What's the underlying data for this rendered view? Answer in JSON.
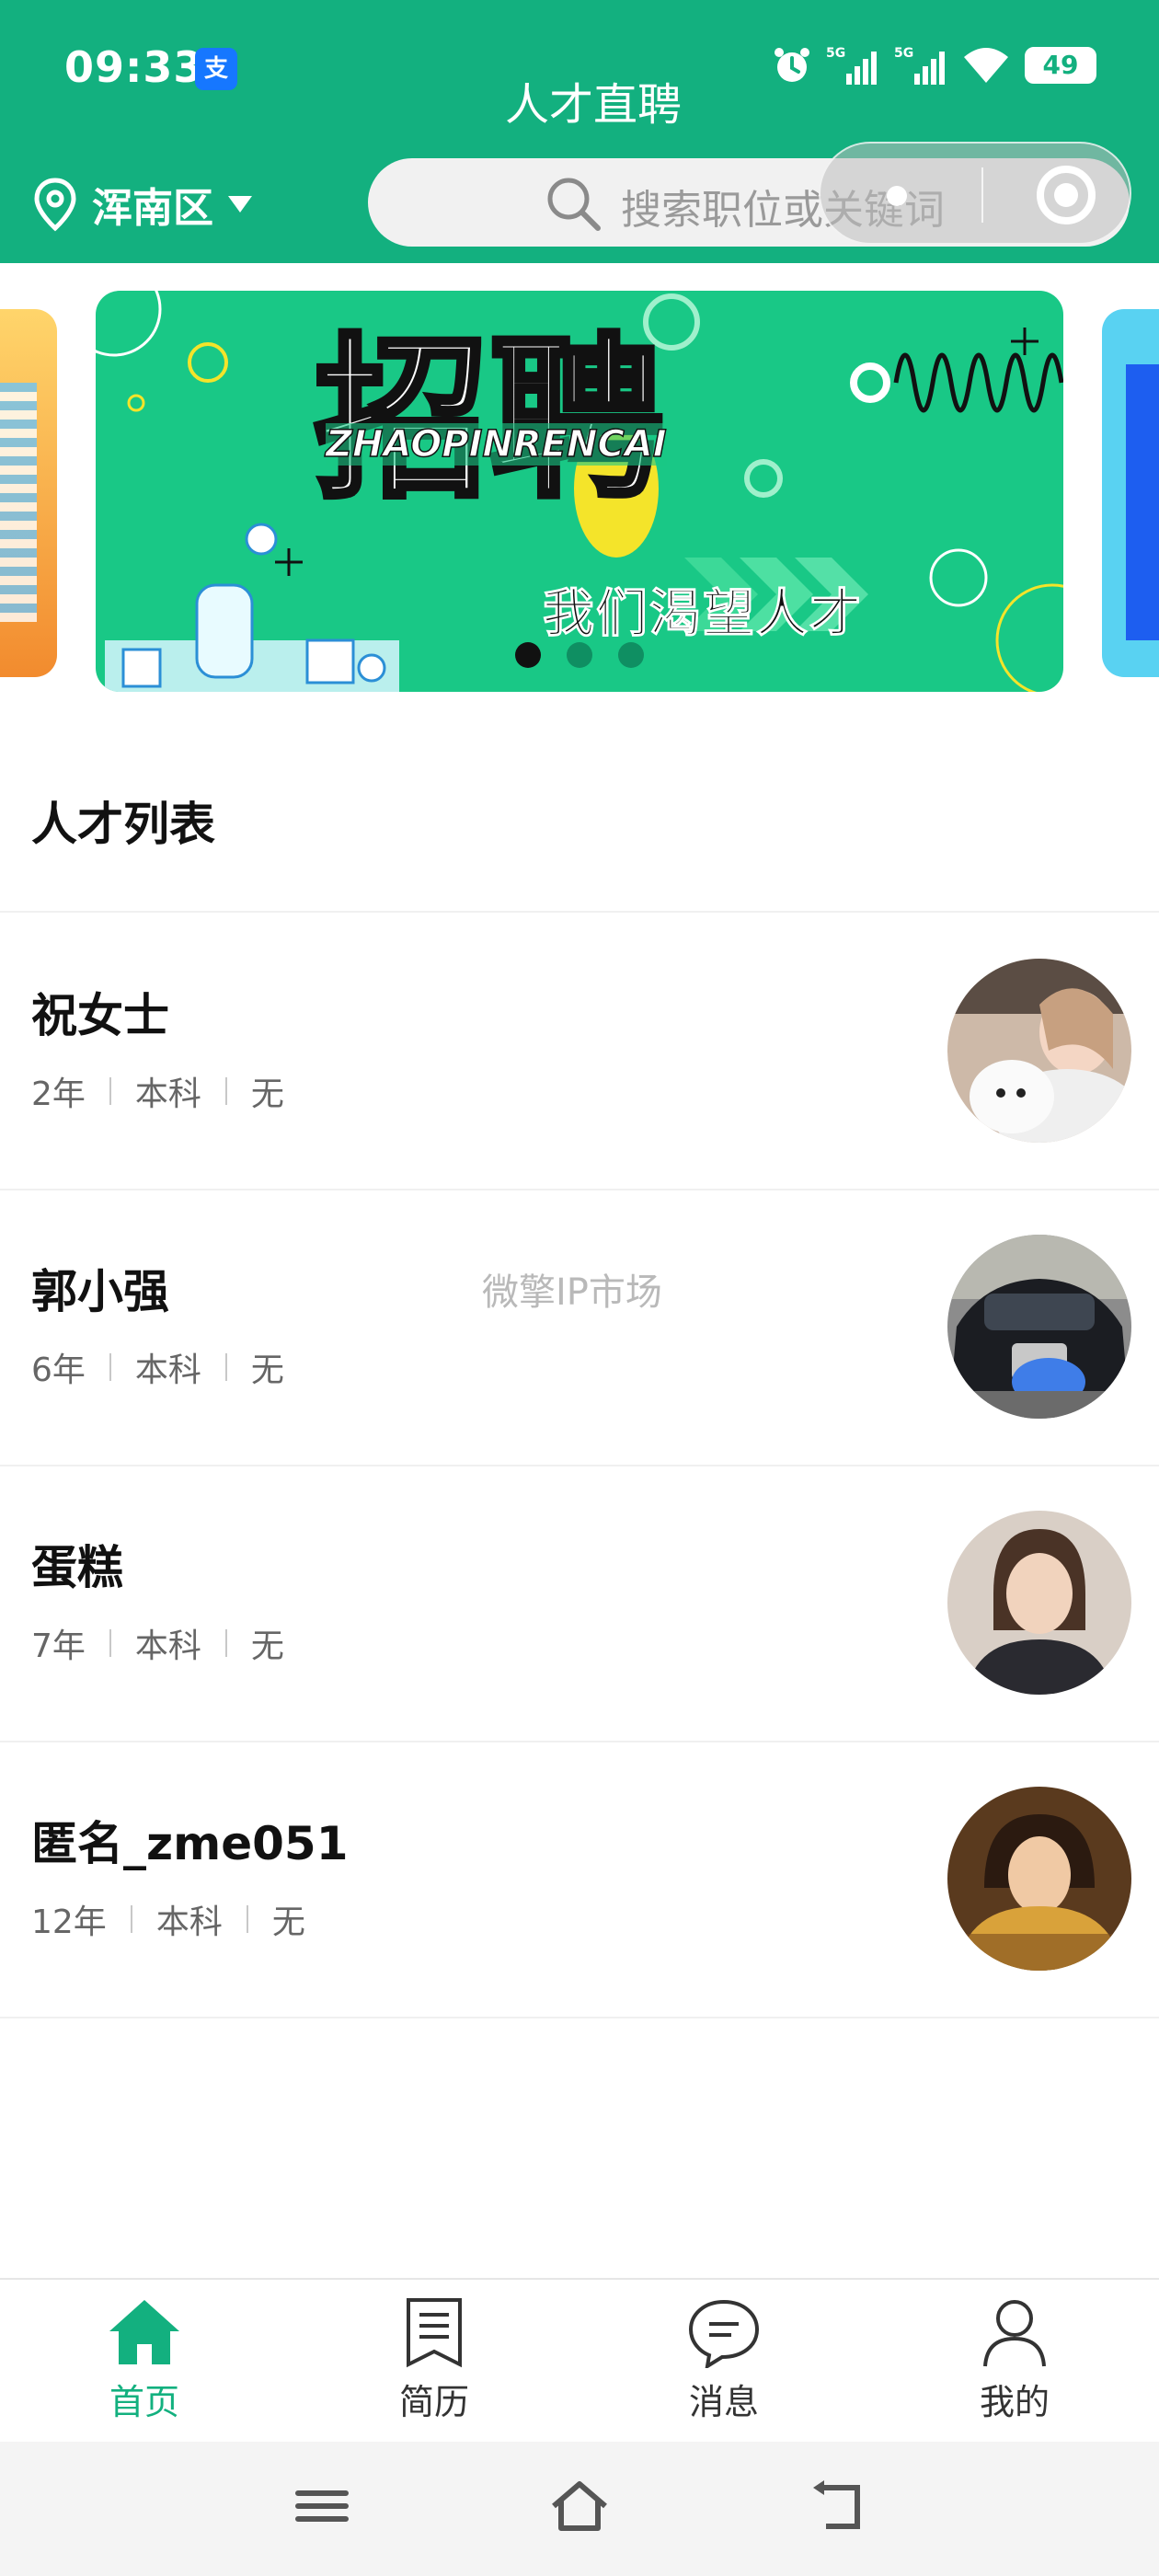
{
  "status_bar": {
    "time": "09:33",
    "app_badge": "支",
    "battery": "49",
    "network_labels": [
      "5G",
      "5G"
    ]
  },
  "header": {
    "title": "人才直聘",
    "location": "浑南区",
    "search_placeholder": "搜索职位或关键词"
  },
  "banner": {
    "title": "招聘",
    "subtitle": "ZHAOPINRENCAI",
    "slogan": "我们渴望人才",
    "slide_count": 3,
    "active_slide": 1
  },
  "talent_list": {
    "title": "人才列表",
    "items": [
      {
        "name": "祝女士",
        "years": "2年",
        "education": "本科",
        "other": "无"
      },
      {
        "name": "郭小强",
        "years": "6年",
        "education": "本科",
        "other": "无"
      },
      {
        "name": "蛋糕",
        "years": "7年",
        "education": "本科",
        "other": "无"
      },
      {
        "name": "匿名_zme051",
        "years": "12年",
        "education": "本科",
        "other": "无"
      }
    ]
  },
  "watermark": "微擎IP市场",
  "tabbar": {
    "items": [
      {
        "label": "首页",
        "icon": "home-icon",
        "active": true
      },
      {
        "label": "简历",
        "icon": "resume-icon",
        "active": false
      },
      {
        "label": "消息",
        "icon": "message-icon",
        "active": false
      },
      {
        "label": "我的",
        "icon": "profile-icon",
        "active": false
      }
    ]
  },
  "colors": {
    "brand": "#13b07f",
    "banner": "#19c886",
    "text": "#111111",
    "meta": "#666666"
  }
}
